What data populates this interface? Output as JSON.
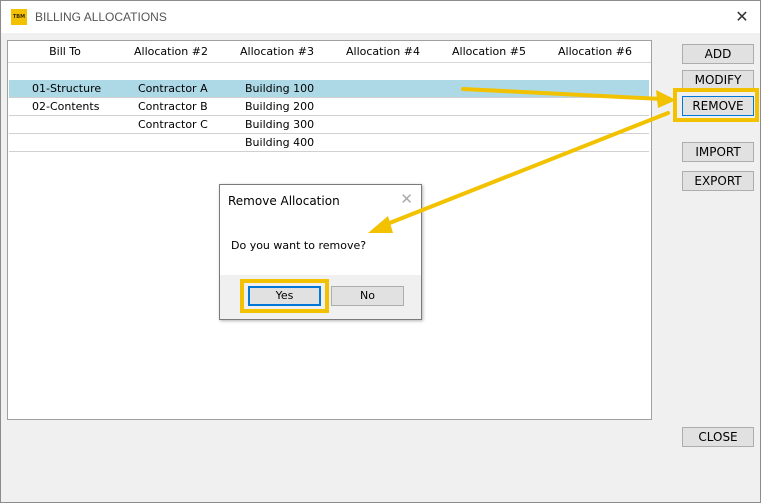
{
  "window": {
    "title": "BILLING ALLOCATIONS",
    "app_icon_text": "TBM",
    "close_glyph": "✕"
  },
  "grid": {
    "columns": [
      "Bill To",
      "Allocation #2",
      "Allocation #3",
      "Allocation #4",
      "Allocation #5",
      "Allocation #6"
    ],
    "rows": [
      {
        "bill_to": "01-Structure",
        "alloc2": "Contractor A",
        "alloc3": "Building 100",
        "selected": true
      },
      {
        "bill_to": "02-Contents",
        "alloc2": "Contractor B",
        "alloc3": "Building 200",
        "selected": false
      },
      {
        "bill_to": "",
        "alloc2": "Contractor C",
        "alloc3": "Building 300",
        "selected": false
      },
      {
        "bill_to": "",
        "alloc2": "",
        "alloc3": "Building 400",
        "selected": false
      }
    ],
    "selection_color": "#add8e6"
  },
  "buttons": {
    "add": "ADD",
    "modify": "MODIFY",
    "remove": "REMOVE",
    "import": "IMPORT",
    "export": "EXPORT",
    "close": "CLOSE"
  },
  "dialog": {
    "title": "Remove Allocation",
    "close_glyph": "✕",
    "message": "Do you want to remove?",
    "yes": "Yes",
    "no": "No"
  },
  "annotation": {
    "highlight_color": "#f2c200",
    "arrow_color": "#f2c200"
  }
}
